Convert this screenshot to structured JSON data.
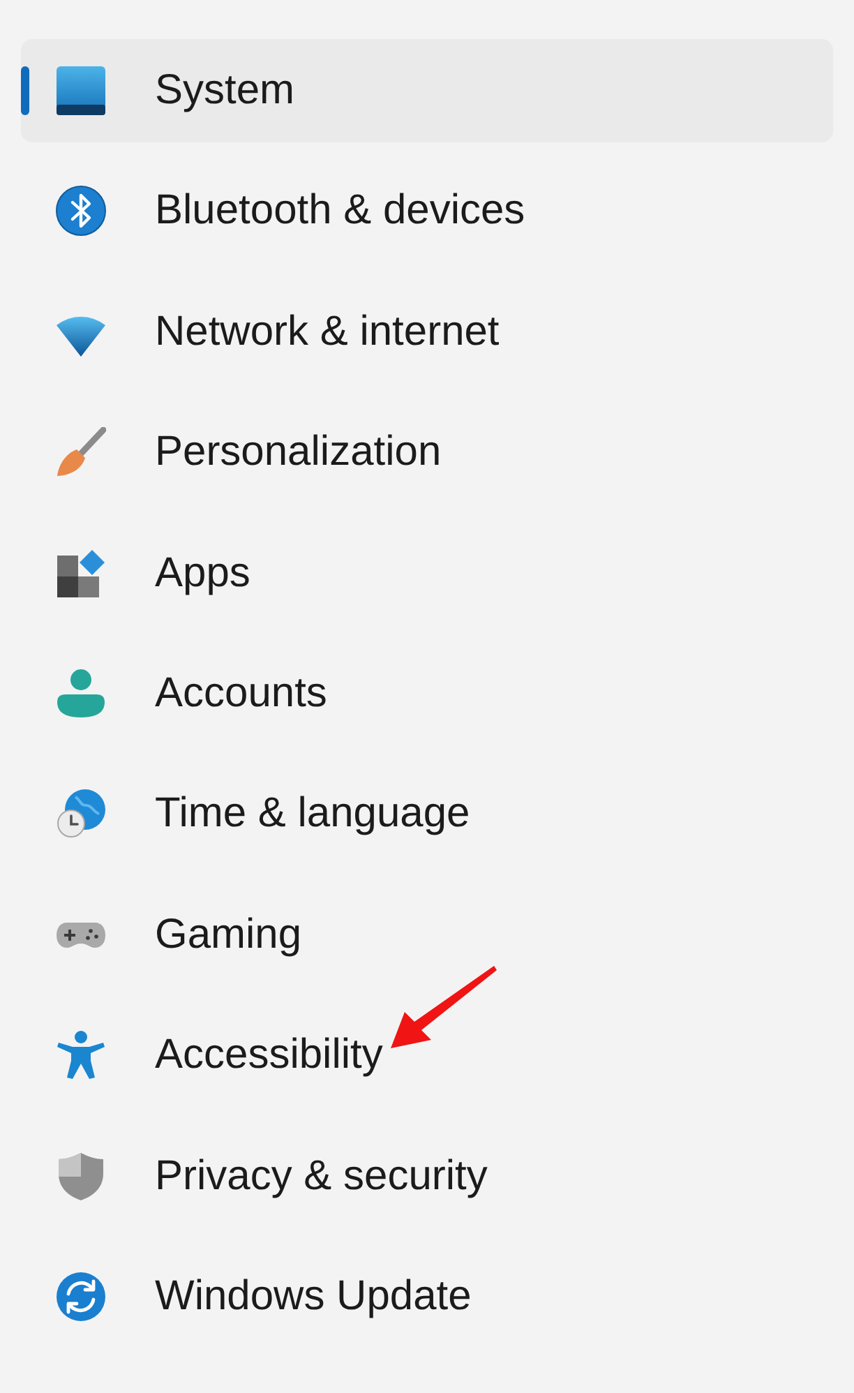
{
  "sidebar": {
    "items": [
      {
        "label": "System",
        "selected": true,
        "arrow": false
      },
      {
        "label": "Bluetooth & devices",
        "selected": false,
        "arrow": false
      },
      {
        "label": "Network & internet",
        "selected": false,
        "arrow": false
      },
      {
        "label": "Personalization",
        "selected": false,
        "arrow": false
      },
      {
        "label": "Apps",
        "selected": false,
        "arrow": false
      },
      {
        "label": "Accounts",
        "selected": false,
        "arrow": false
      },
      {
        "label": "Time & language",
        "selected": false,
        "arrow": false
      },
      {
        "label": "Gaming",
        "selected": false,
        "arrow": false
      },
      {
        "label": "Accessibility",
        "selected": false,
        "arrow": true
      },
      {
        "label": "Privacy & security",
        "selected": false,
        "arrow": false
      },
      {
        "label": "Windows Update",
        "selected": false,
        "arrow": false
      }
    ]
  }
}
